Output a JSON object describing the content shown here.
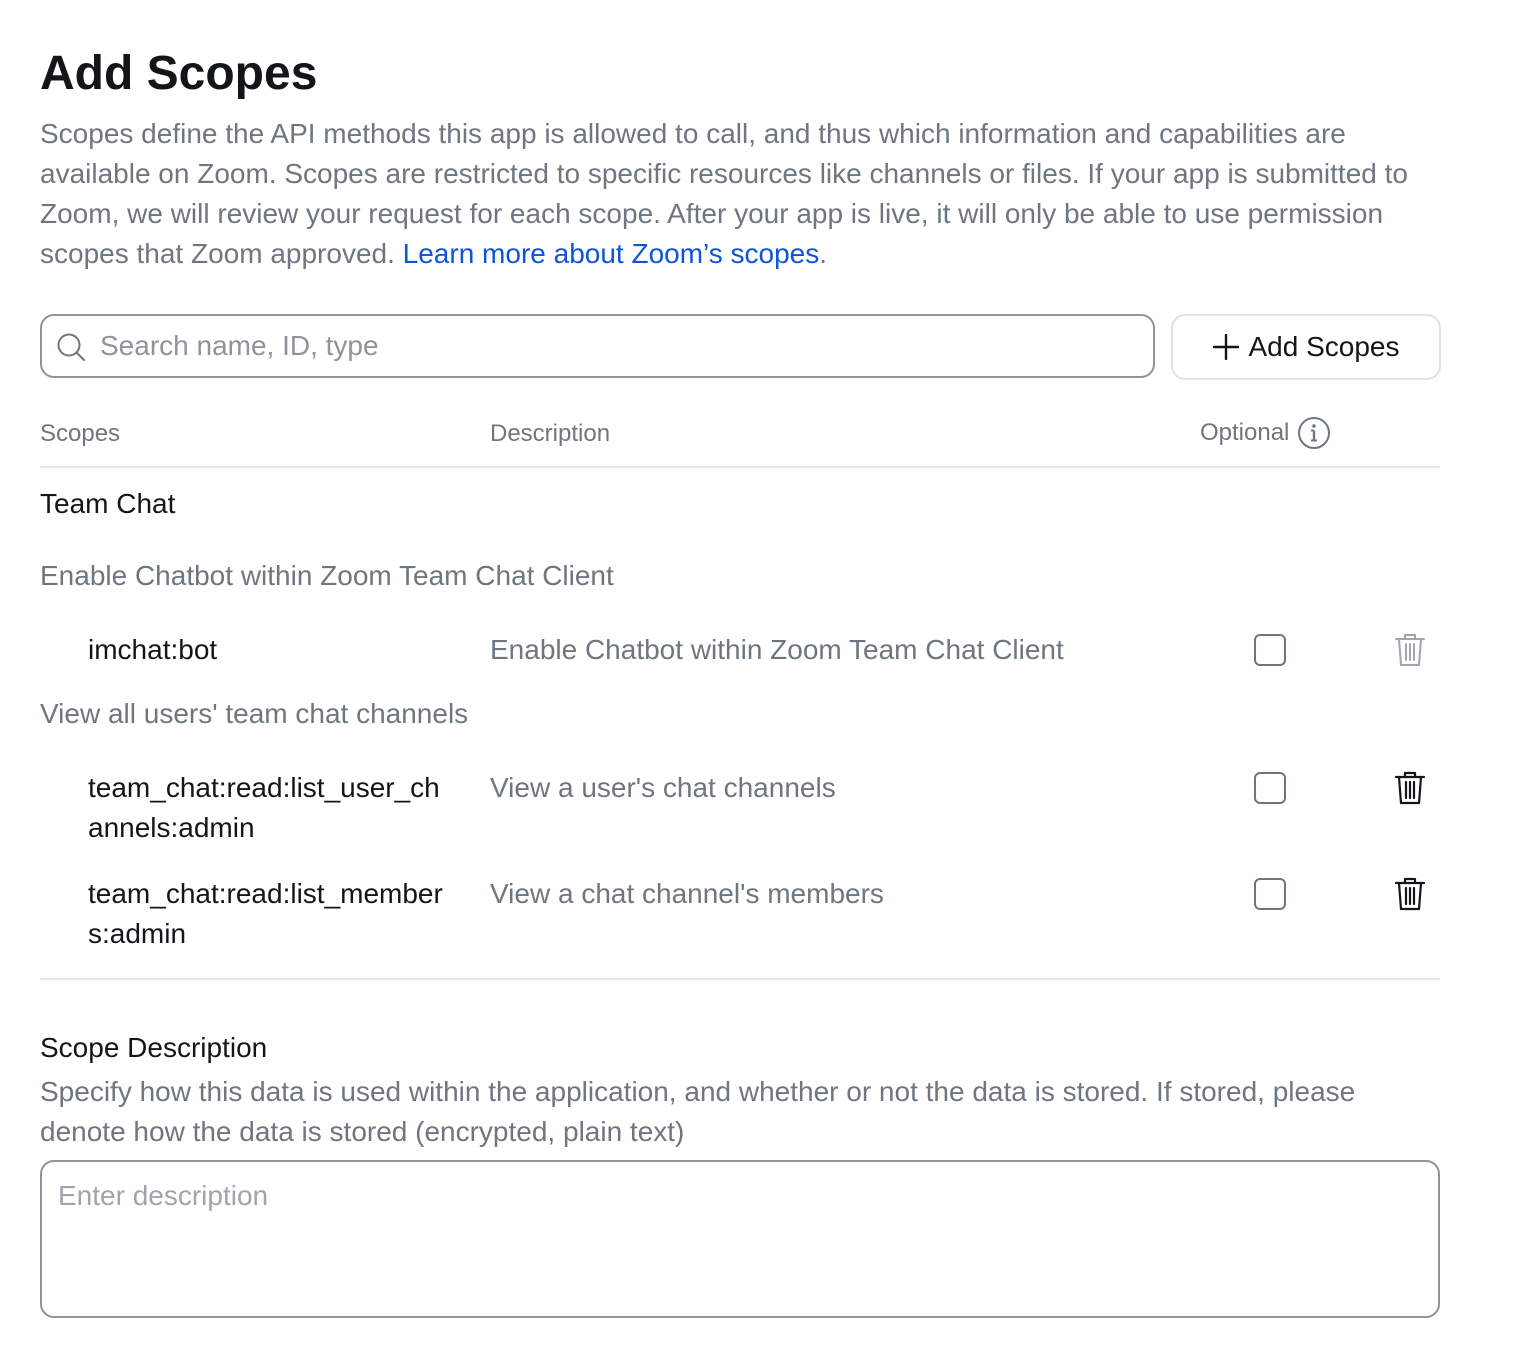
{
  "header": {
    "title": "Add Scopes",
    "intro_text": "Scopes define the API methods this app is allowed to call, and thus which information and capabilities are available on Zoom. Scopes are restricted to specific resources like channels or files. If your app is submitted to Zoom, we will review your request for each scope. After your app is live, it will only be able to use permission scopes that Zoom approved. ",
    "learn_more_link": "Learn more about Zoom’s scopes",
    "trailing_period": "."
  },
  "search": {
    "placeholder": "Search name, ID, type",
    "value": ""
  },
  "add_button": {
    "label": "Add Scopes"
  },
  "table": {
    "columns": {
      "scopes": "Scopes",
      "description": "Description",
      "optional": "Optional"
    },
    "groups": [
      {
        "title": "Team Chat",
        "subgroups": [
          {
            "title": "Enable Chatbot within Zoom Team Chat Client",
            "rows": [
              {
                "scope": "imchat:bot",
                "description": "Enable Chatbot within Zoom Team Chat Client",
                "optional": false,
                "delete_enabled": false
              }
            ]
          },
          {
            "title": "View all users' team chat channels",
            "rows": [
              {
                "scope": "team_chat:read:list_user_channels:admin",
                "description": "View a user's chat channels",
                "optional": false,
                "delete_enabled": true
              },
              {
                "scope": "team_chat:read:list_members:admin",
                "description": "View a chat channel's members",
                "optional": false,
                "delete_enabled": true
              }
            ]
          }
        ]
      }
    ]
  },
  "scope_description": {
    "title": "Scope Description",
    "help_text": "Specify how this data is used within the application, and whether or not the data is stored. If stored, please denote how the data is stored (encrypted, plain text)",
    "placeholder": "Enter description",
    "value": ""
  },
  "colors": {
    "text_primary": "#131619",
    "text_secondary": "#6e7680",
    "link": "#0e55d6",
    "border": "#8f949a",
    "divider": "#e4e6ea",
    "icon_disabled": "#a0a5ab"
  }
}
